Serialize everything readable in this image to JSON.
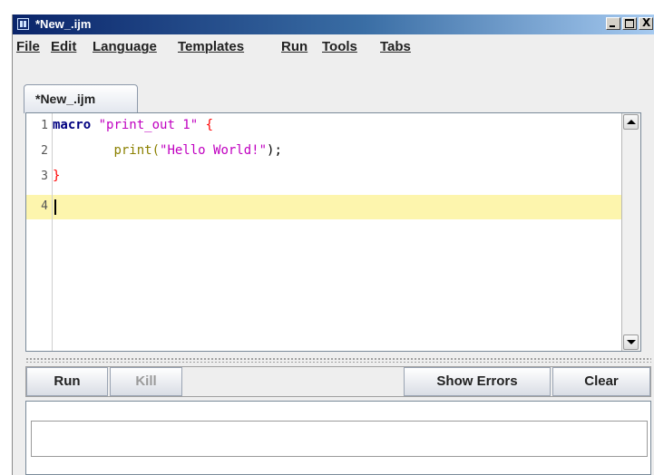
{
  "window": {
    "title": "*New_.ijm",
    "controls": {
      "minimize": "_",
      "maximize": "□",
      "close": "X"
    }
  },
  "menu": [
    "File",
    "Edit",
    "Language",
    "Templates",
    "Run",
    "Tools",
    "Tabs"
  ],
  "tabs": [
    {
      "label": "*New_.ijm",
      "active": true
    }
  ],
  "editor": {
    "line_numbers": [
      "1",
      "2",
      "3",
      "4"
    ],
    "lines": [
      {
        "keyword": "macro",
        "space": " ",
        "string": "\"print_out 1\"",
        "space2": " ",
        "brace": "{"
      },
      {
        "indent": "        ",
        "fn": "print(",
        "string": "\"Hello World!\"",
        "fn_close": ");"
      },
      {
        "brace": "}"
      },
      {
        "text": ""
      }
    ],
    "current_line": 4,
    "colors": {
      "keyword": "#000080",
      "string": "#c000c0",
      "brace": "#ff0000",
      "function": "#8b8000",
      "current_line_bg": "#fdf5ad"
    }
  },
  "buttons": {
    "run": "Run",
    "kill": "Kill",
    "show_errors": "Show Errors",
    "clear": "Clear"
  },
  "output": {
    "text": ""
  }
}
